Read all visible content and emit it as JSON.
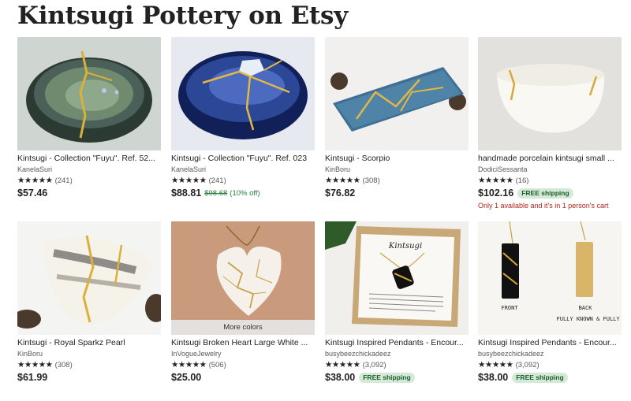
{
  "page": {
    "title": "Kintsugi Pottery on Etsy"
  },
  "listings": [
    {
      "title": "Kintsugi - Collection \"Fuyu\". Ref. 52...",
      "shop": "KanelaSuri",
      "stars": "★★★★★",
      "reviews": "(241)",
      "price": "$57.46"
    },
    {
      "title": "Kintsugi - Collection \"Fuyu\". Ref. 023",
      "shop": "KanelaSuri",
      "stars": "★★★★★",
      "reviews": "(241)",
      "price": "$88.81",
      "original_price": "$98.68",
      "discount": "(10% off)"
    },
    {
      "title": "Kintsugi - Scorpio",
      "shop": "KinBoru",
      "stars": "★★★★★",
      "reviews": "(308)",
      "price": "$76.82"
    },
    {
      "title": "handmade porcelain kintsugi small ...",
      "shop": "DodiciSessanta",
      "stars": "★★★★★",
      "reviews": "(16)",
      "price": "$102.16",
      "badge": "FREE shipping",
      "notice": "Only 1 available and it's in 1 person's cart"
    },
    {
      "title": "Kintsugi - Royal Sparkz Pearl",
      "shop": "KinBoru",
      "stars": "★★★★★",
      "reviews": "(308)",
      "price": "$61.99"
    },
    {
      "title": "Kintsugi Broken Heart Large White ...",
      "shop": "InVogueJewelry",
      "stars": "★★★★★",
      "reviews": "(506)",
      "price": "$25.00",
      "overlay": "More colors"
    },
    {
      "title": "Kintsugi Inspired Pendants - Encour...",
      "shop": "busybeezchickadeez",
      "stars": "★★★★★",
      "reviews": "(3,092)",
      "price": "$38.00",
      "badge": "FREE shipping",
      "image_text": "Kintsugi"
    },
    {
      "title": "Kintsugi Inspired Pendants - Encour...",
      "shop": "busybeezchickadeez",
      "stars": "★★★★★",
      "reviews": "(3,092)",
      "price": "$38.00",
      "badge": "FREE shipping",
      "image_text": [
        "FRONT",
        "BACK",
        "FULLY KNOWN & FULLY LOV"
      ]
    }
  ]
}
